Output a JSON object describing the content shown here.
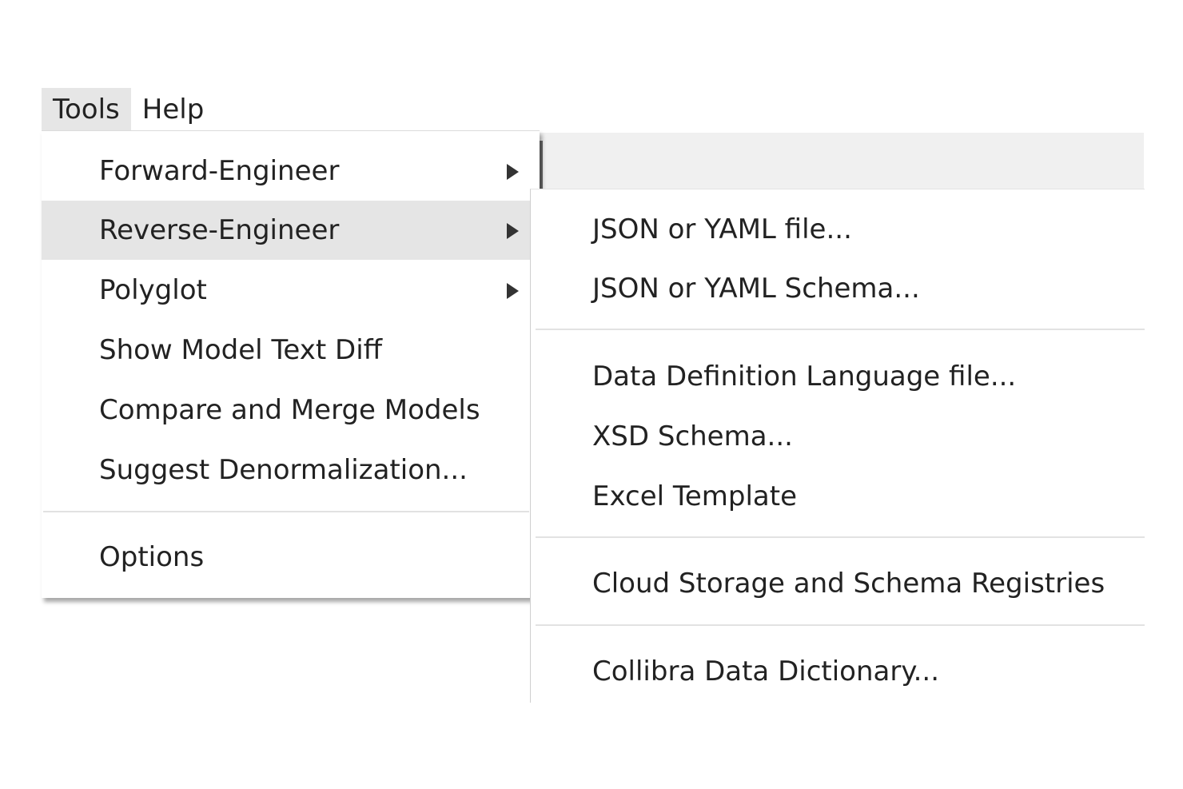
{
  "menubar": {
    "items": [
      {
        "label": "Tools",
        "active": true
      },
      {
        "label": "Help",
        "active": false
      }
    ]
  },
  "tools_menu": {
    "items": [
      {
        "label": "Forward-Engineer",
        "has_submenu": true
      },
      {
        "label": "Reverse-Engineer",
        "has_submenu": true,
        "highlighted": true
      },
      {
        "label": "Polyglot",
        "has_submenu": true
      },
      {
        "label": "Show Model Text Diff",
        "has_submenu": false
      },
      {
        "label": "Compare and Merge Models",
        "has_submenu": false
      },
      {
        "label": "Suggest Denormalization...",
        "has_submenu": false
      },
      {
        "label": "Options",
        "has_submenu": false
      }
    ]
  },
  "reverse_engineer_submenu": {
    "items": [
      {
        "label": "JSON or YAML file..."
      },
      {
        "label": "JSON or YAML Schema..."
      },
      {
        "label": "Data Definition Language file..."
      },
      {
        "label": "XSD Schema..."
      },
      {
        "label": "Excel Template"
      },
      {
        "label": "Cloud Storage and Schema Registries"
      },
      {
        "label": "Collibra Data Dictionary..."
      }
    ]
  },
  "colors": {
    "highlight": "#e5e5e5",
    "menubar_active": "#e6e6e6",
    "separator": "#e2e2e2",
    "text": "#222222",
    "arrow": "#333333"
  }
}
